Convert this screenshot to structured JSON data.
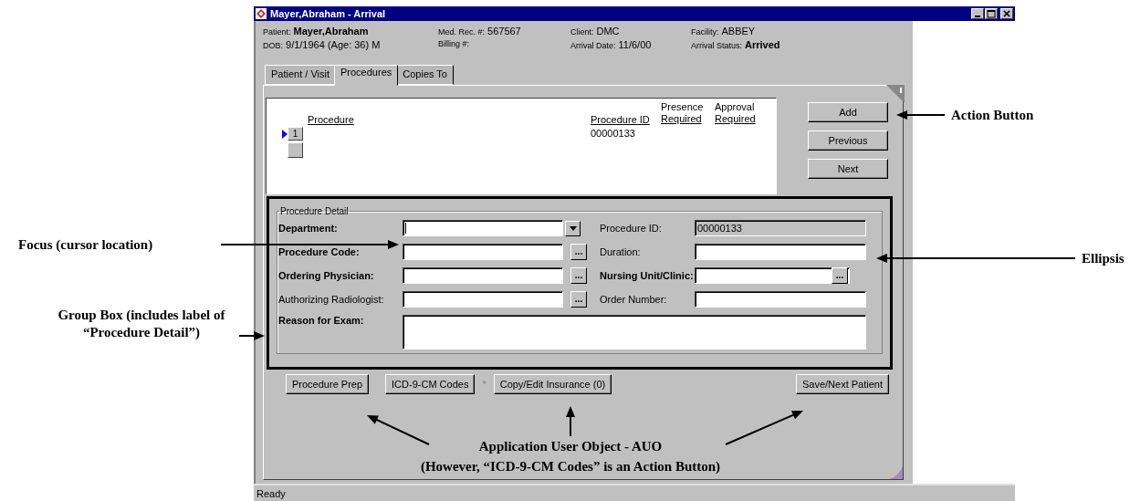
{
  "window": {
    "title": "Mayer,Abraham - Arrival"
  },
  "header": [
    {
      "label": "Patient:",
      "value": "Mayer,Abraham",
      "bold": true
    },
    {
      "label": "Med. Rec. #:",
      "value": "567567",
      "bold": false
    },
    {
      "label": "Client:",
      "value": "DMC",
      "bold": false
    },
    {
      "label": "Facility:",
      "value": "ABBEY",
      "bold": false
    },
    {
      "label": "DOB:",
      "value": "9/1/1964 (Age: 36) M",
      "bold": false
    },
    {
      "label": "Billing #:",
      "bold": false
    },
    {
      "label": "Arrival Date:",
      "value": "11/6/00",
      "bold": false
    },
    {
      "label": "Arrival Status:",
      "value": "Arrived",
      "bold": true
    }
  ],
  "tabs": [
    {
      "label": "Patient / Visit",
      "selected": false
    },
    {
      "label": "Procedures",
      "selected": true
    },
    {
      "label": "Copies To",
      "selected": false
    }
  ],
  "table": {
    "columns": [
      "Procedure",
      "Procedure ID",
      [
        "Presence",
        "Required"
      ],
      [
        "Approval",
        "Required"
      ]
    ],
    "rows": [
      {
        "number": "1",
        "procedure_id": "00000133",
        "selected": true
      }
    ]
  },
  "side_buttons": [
    "Add",
    "Previous",
    "Next"
  ],
  "group_box": {
    "title": "Procedure Detail"
  },
  "fields": [
    {
      "label": "Department:",
      "kind": "dropdown",
      "bold": true,
      "focused": true
    },
    {
      "label": "Procedure ID:",
      "kind": "readonly",
      "bold": false,
      "value": "00000133"
    },
    {
      "label": "Procedure Code:",
      "kind": "lookup",
      "bold": true,
      "button": "..."
    },
    {
      "label": "Duration:",
      "kind": "text",
      "bold": false
    },
    {
      "label": "Ordering Physician:",
      "kind": "lookup",
      "bold": true,
      "button": "..."
    },
    {
      "label": "Nursing Unit/Clinic:",
      "kind": "lookup",
      "bold": true,
      "button": "..."
    },
    {
      "label": "Authorizing Radiologist:",
      "kind": "lookup",
      "bold": false,
      "button": "..."
    },
    {
      "label": "Order Number:",
      "kind": "text",
      "bold": false
    },
    {
      "label": "Reason for Exam:",
      "kind": "memo",
      "bold": true
    }
  ],
  "bottom_buttons": [
    {
      "label": "Procedure Prep"
    },
    {
      "label": "ICD-9-CM Codes",
      "suffix": "*"
    },
    {
      "label": "Copy/Edit Insurance (0)"
    },
    {
      "label": "Save/Next Patient"
    }
  ],
  "status_bar": "Ready",
  "annotations": [
    {
      "text": "Action Button"
    },
    {
      "text": "Focus (cursor location)"
    },
    {
      "text": "Ellipsis"
    },
    {
      "text": "Group Box (includes label of “Procedure Detail”)"
    },
    {
      "text": "Application User Object - AUO"
    },
    {
      "text": "(However, “ICD-9-CM Codes” is an Action Button)"
    }
  ]
}
